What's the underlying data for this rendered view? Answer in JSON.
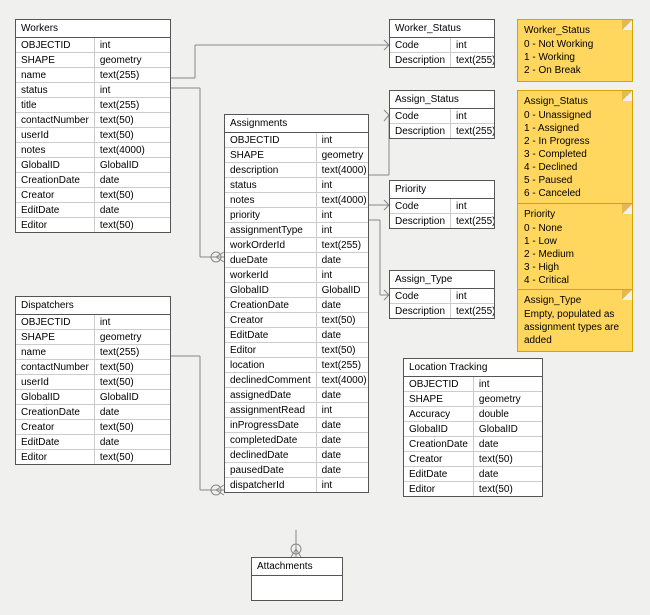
{
  "entities": {
    "workers": {
      "title": "Workers",
      "rows": [
        [
          "OBJECTID",
          "int"
        ],
        [
          "SHAPE",
          "geometry"
        ],
        [
          "name",
          "text(255)"
        ],
        [
          "status",
          "int"
        ],
        [
          "title",
          "text(255)"
        ],
        [
          "contactNumber",
          "text(50)"
        ],
        [
          "userId",
          "text(50)"
        ],
        [
          "notes",
          "text(4000)"
        ],
        [
          "GlobalID",
          "GlobalID"
        ],
        [
          "CreationDate",
          "date"
        ],
        [
          "Creator",
          "text(50)"
        ],
        [
          "EditDate",
          "date"
        ],
        [
          "Editor",
          "text(50)"
        ]
      ]
    },
    "dispatchers": {
      "title": "Dispatchers",
      "rows": [
        [
          "OBJECTID",
          "int"
        ],
        [
          "SHAPE",
          "geometry"
        ],
        [
          "name",
          "text(255)"
        ],
        [
          "contactNumber",
          "text(50)"
        ],
        [
          "userId",
          "text(50)"
        ],
        [
          "GlobalID",
          "GlobalID"
        ],
        [
          "CreationDate",
          "date"
        ],
        [
          "Creator",
          "text(50)"
        ],
        [
          "EditDate",
          "date"
        ],
        [
          "Editor",
          "text(50)"
        ]
      ]
    },
    "assignments": {
      "title": "Assignments",
      "rows": [
        [
          "OBJECTID",
          "int"
        ],
        [
          "SHAPE",
          "geometry"
        ],
        [
          "description",
          "text(4000)"
        ],
        [
          "status",
          "int"
        ],
        [
          "notes",
          "text(4000)"
        ],
        [
          "priority",
          "int"
        ],
        [
          "assignmentType",
          "int"
        ],
        [
          "workOrderId",
          "text(255)"
        ],
        [
          "dueDate",
          "date"
        ],
        [
          "workerId",
          "int"
        ],
        [
          "GlobalID",
          "GlobalID"
        ],
        [
          "CreationDate",
          "date"
        ],
        [
          "Creator",
          "text(50)"
        ],
        [
          "EditDate",
          "date"
        ],
        [
          "Editor",
          "text(50)"
        ],
        [
          "location",
          "text(255)"
        ],
        [
          "declinedComment",
          "text(4000)"
        ],
        [
          "assignedDate",
          "date"
        ],
        [
          "assignmentRead",
          "int"
        ],
        [
          "inProgressDate",
          "date"
        ],
        [
          "completedDate",
          "date"
        ],
        [
          "declinedDate",
          "date"
        ],
        [
          "pausedDate",
          "date"
        ],
        [
          "dispatcherId",
          "int"
        ]
      ]
    },
    "attachments": {
      "title": "Attachments",
      "rows": []
    },
    "worker_status": {
      "title": "Worker_Status",
      "rows": [
        [
          "Code",
          "int"
        ],
        [
          "Description",
          "text(255)"
        ]
      ]
    },
    "assign_status": {
      "title": "Assign_Status",
      "rows": [
        [
          "Code",
          "int"
        ],
        [
          "Description",
          "text(255)"
        ]
      ]
    },
    "priority": {
      "title": "Priority",
      "rows": [
        [
          "Code",
          "int"
        ],
        [
          "Description",
          "text(255)"
        ]
      ]
    },
    "assign_type": {
      "title": "Assign_Type",
      "rows": [
        [
          "Code",
          "int"
        ],
        [
          "Description",
          "text(255)"
        ]
      ]
    },
    "location_tracking": {
      "title": "Location Tracking",
      "rows": [
        [
          "OBJECTID",
          "int"
        ],
        [
          "SHAPE",
          "geometry"
        ],
        [
          "Accuracy",
          "double"
        ],
        [
          "GlobalID",
          "GlobalID"
        ],
        [
          "CreationDate",
          "date"
        ],
        [
          "Creator",
          "text(50)"
        ],
        [
          "EditDate",
          "date"
        ],
        [
          "Editor",
          "text(50)"
        ]
      ]
    }
  },
  "notes": {
    "worker_status": {
      "title": "Worker_Status",
      "lines": [
        "0 - Not Working",
        "1 - Working",
        "2 - On Break"
      ]
    },
    "assign_status": {
      "title": "Assign_Status",
      "lines": [
        "0 - Unassigned",
        "1 - Assigned",
        "2 - In Progress",
        "3 - Completed",
        "4 - Declined",
        "5 - Paused",
        "6 - Canceled"
      ]
    },
    "priority": {
      "title": "Priority",
      "lines": [
        "0 - None",
        "1 - Low",
        "2 - Medium",
        "3 - High",
        "4 - Critical"
      ]
    },
    "assign_type": {
      "title": "Assign_Type",
      "lines": [
        "Empty, populated as",
        "assignment types are added"
      ]
    }
  }
}
